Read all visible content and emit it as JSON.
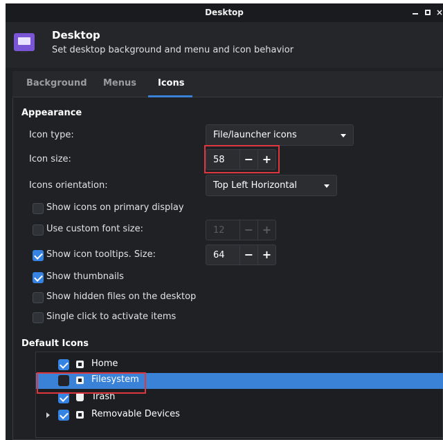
{
  "window": {
    "title": "Desktop",
    "controls": {
      "minimize": "minimize",
      "maximize": "maximize",
      "close": "×"
    }
  },
  "header": {
    "title": "Desktop",
    "subtitle": "Set desktop background and menu and icon behavior",
    "icon": "desktop-monitor-icon"
  },
  "tabs": [
    {
      "label": "Background",
      "active": false
    },
    {
      "label": "Menus",
      "active": false
    },
    {
      "label": "Icons",
      "active": true
    }
  ],
  "appearance": {
    "heading": "Appearance",
    "icon_type": {
      "label": "Icon type:",
      "value": "File/launcher icons"
    },
    "icon_size": {
      "label": "Icon size:",
      "value": "58",
      "minus": "−",
      "plus": "+"
    },
    "icons_orientation": {
      "label": "Icons orientation:",
      "value": "Top Left Horizontal"
    },
    "checkboxes": [
      {
        "label": "Show icons on primary display",
        "checked": false
      },
      {
        "label": "Use custom font size:",
        "checked": false
      },
      {
        "label": "Show icon tooltips. Size:",
        "checked": true
      },
      {
        "label": "Show thumbnails",
        "checked": true
      },
      {
        "label": "Show hidden files on the desktop",
        "checked": false
      },
      {
        "label": "Single click to activate items",
        "checked": false
      }
    ],
    "custom_font_size": {
      "value": "12",
      "minus": "−",
      "plus": "+",
      "enabled": false
    },
    "tooltip_size": {
      "value": "64",
      "minus": "−",
      "plus": "+",
      "enabled": true
    }
  },
  "default_icons": {
    "heading": "Default Icons",
    "items": [
      {
        "label": "Home",
        "checked": true,
        "icon": "home-icon",
        "selected": false
      },
      {
        "label": "Filesystem",
        "checked": false,
        "icon": "filesystem-icon",
        "selected": true
      },
      {
        "label": "Trash",
        "checked": true,
        "icon": "trash-icon",
        "selected": false
      },
      {
        "label": "Removable Devices",
        "checked": true,
        "icon": "removable-device-icon",
        "selected": false,
        "expandable": true
      }
    ]
  },
  "colors": {
    "accent": "#3a82d8",
    "highlight_box": "#e0373f",
    "background": "#1f2125"
  }
}
